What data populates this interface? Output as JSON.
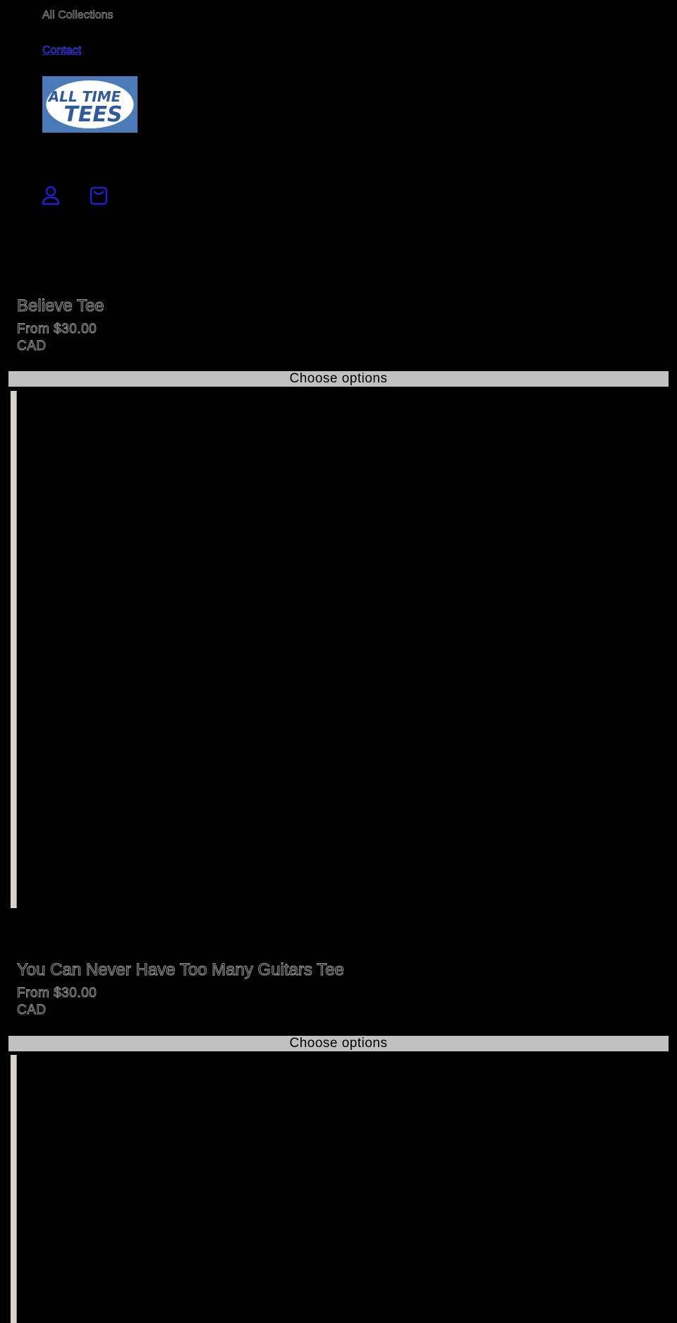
{
  "header": {
    "nav": [
      {
        "label": "All Collections"
      },
      {
        "label": "Contact"
      }
    ],
    "logo": {
      "line1": "ALL TIME",
      "line2": "TEES",
      "bg_color": "#4a7ab8"
    },
    "icons": [
      "account-icon",
      "cart-icon"
    ]
  },
  "products": [
    {
      "title": "Believe Tee",
      "price": "From $30.00",
      "currency": "CAD",
      "button_label": "Choose options"
    },
    {
      "title": "You Can Never Have Too Many Guitars Tee",
      "price": "From $30.00",
      "currency": "CAD",
      "button_label": "Choose options"
    }
  ],
  "colors": {
    "background": "#000000",
    "button": "#c0c0c0",
    "link": "#2020c0",
    "image_frame": "#d8d4c8"
  }
}
